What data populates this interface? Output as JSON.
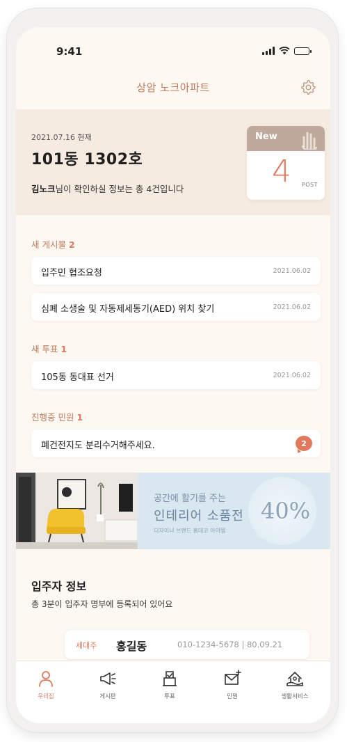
{
  "status_bar": {
    "time": "9:41"
  },
  "header": {
    "title": "상암 노크아파트"
  },
  "summary": {
    "date": "2021.07.16 현재",
    "unit": "101동 1302호",
    "user_name": "김노크",
    "message": "님이 확인하실 정보는 총 4건입니다",
    "card": {
      "new_label": "New",
      "count": "4",
      "post_label": "POST"
    }
  },
  "sections": [
    {
      "title": "새 게시물",
      "count": "2",
      "items": [
        {
          "label": "입주민 협조요청",
          "date": "2021.06.02"
        },
        {
          "label": "심폐 소생술 및 자동제세동기(AED) 위치 찾기",
          "date": "2021.06.02"
        }
      ]
    },
    {
      "title": "새 투표",
      "count": "1",
      "items": [
        {
          "label": "105동 동대표 선거",
          "date": "2021.06.02"
        }
      ]
    },
    {
      "title": "진행중 민원",
      "count": "1",
      "items": [
        {
          "label": "폐건전지도 분리수거해주세요.",
          "badge": "2"
        }
      ]
    }
  ],
  "banner": {
    "line1": "공간에 활기를 주는",
    "line2": "인테리어 소품전",
    "line3": "디자이너 브랜드 홈데코 아이템",
    "percent": "40%"
  },
  "residents": {
    "title": "입주자 정보",
    "subtitle": "총 3분이 입주자 명부에 등록되어 있어요",
    "card": {
      "role": "세대주",
      "name": "홍길동",
      "info": "010-1234-5678  |  80.09.21"
    }
  },
  "nav": [
    {
      "label": "우리집",
      "icon": "person-icon",
      "active": true
    },
    {
      "label": "게시판",
      "icon": "megaphone-icon",
      "active": false
    },
    {
      "label": "투표",
      "icon": "ballot-box-icon",
      "active": false
    },
    {
      "label": "민원",
      "icon": "mail-icon",
      "active": false
    },
    {
      "label": "생활서비스",
      "icon": "home-service-icon",
      "active": false
    }
  ],
  "colors": {
    "accent": "#e1795c",
    "brand": "#c07a5c",
    "background": "#fdf8f2",
    "summary_bg": "#f6ebe1",
    "banner_bg": "#d9e7f0"
  }
}
